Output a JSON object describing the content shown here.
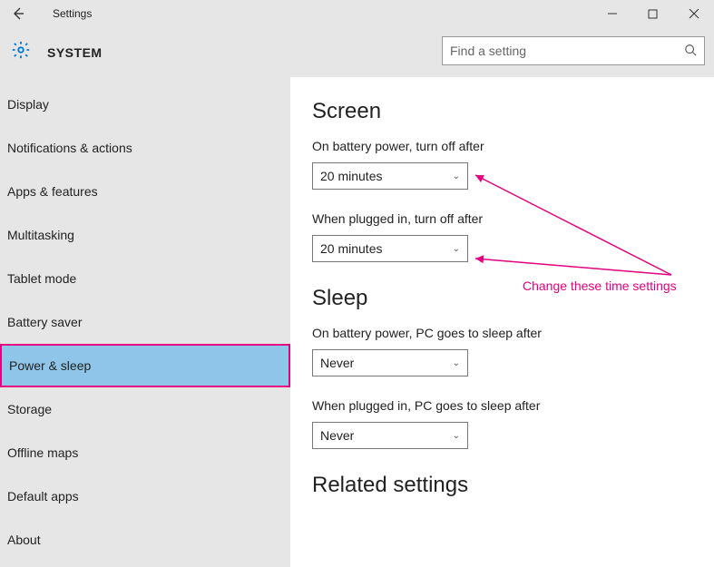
{
  "window": {
    "title": "Settings"
  },
  "header": {
    "system_label": "SYSTEM",
    "search_placeholder": "Find a setting"
  },
  "sidebar": {
    "items": [
      {
        "label": "Display"
      },
      {
        "label": "Notifications & actions"
      },
      {
        "label": "Apps & features"
      },
      {
        "label": "Multitasking"
      },
      {
        "label": "Tablet mode"
      },
      {
        "label": "Battery saver"
      },
      {
        "label": "Power & sleep"
      },
      {
        "label": "Storage"
      },
      {
        "label": "Offline maps"
      },
      {
        "label": "Default apps"
      },
      {
        "label": "About"
      }
    ]
  },
  "content": {
    "screen_heading": "Screen",
    "screen_battery_label": "On battery power, turn off after",
    "screen_battery_value": "20 minutes",
    "screen_plugged_label": "When plugged in, turn off after",
    "screen_plugged_value": "20 minutes",
    "sleep_heading": "Sleep",
    "sleep_battery_label": "On battery power, PC goes to sleep after",
    "sleep_battery_value": "Never",
    "sleep_plugged_label": "When plugged in, PC goes to sleep after",
    "sleep_plugged_value": "Never",
    "related_heading": "Related settings"
  },
  "annotation": {
    "text": "Change these time settings",
    "color": "#e4007f"
  }
}
